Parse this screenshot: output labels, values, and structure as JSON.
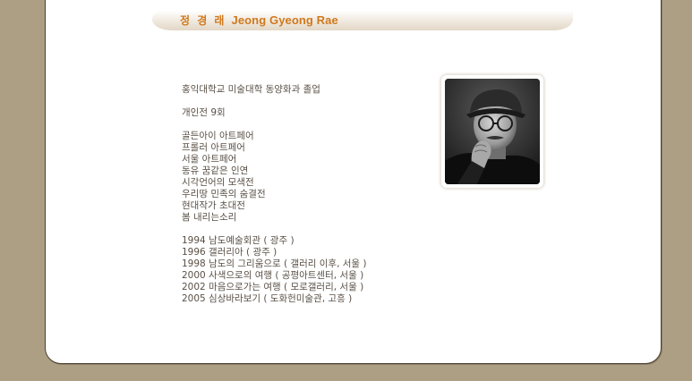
{
  "title": {
    "korean_name": "정 경 래",
    "english_name": "Jeong Gyeong Rae"
  },
  "profile": {
    "education": "홍익대학교 미술대학 동양화과 졸업",
    "solo_count": "개인전 9회",
    "exhibitions": [
      "골든아이 아트페어",
      "프롤러 아트페어",
      "서울 아트페어",
      "동유 꿈같은 인연",
      "시각언어의 모색전",
      "우리땅 민족의 숨결전",
      "현대작가 초대전",
      "봄 내리는소리"
    ],
    "solo_shows": [
      "1994 남도예술회관 ( 광주 )",
      "1996 갤러리아 ( 광주 )",
      "1998 남도의 그리움으로 ( 갤러리 이후, 서울 )",
      "2000 사색으로의 여행 ( 공평아트센터, 서울 )",
      "2002 마음으로가는 여행 ( 모로갤러리, 서울 )",
      "2005 심상바라보기 ( 도화헌미술관, 고흥 )"
    ]
  },
  "colors": {
    "background": "#ad9f83",
    "title_accent": "#d0791d",
    "body_text": "#5a5046"
  }
}
